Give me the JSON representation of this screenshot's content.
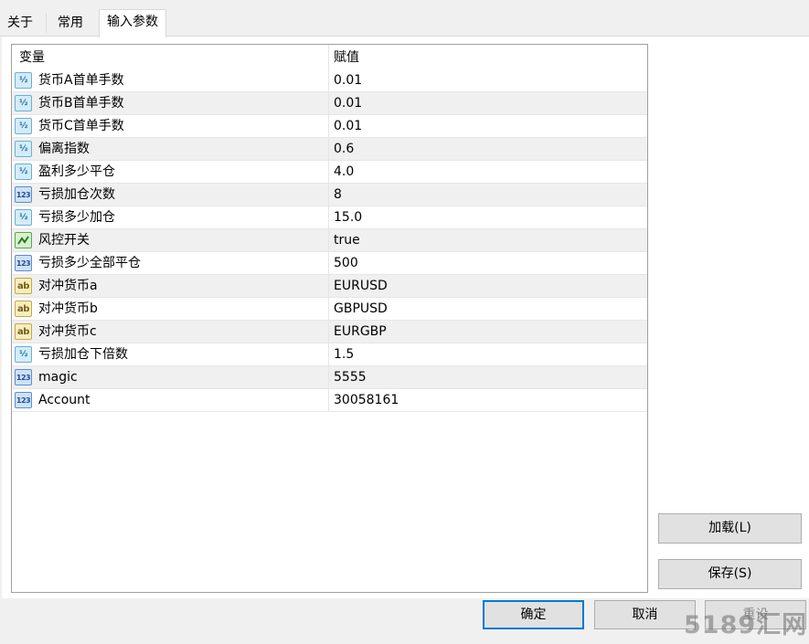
{
  "tabs": [
    {
      "label": "关于"
    },
    {
      "label": "常用"
    },
    {
      "label": "输入参数"
    }
  ],
  "grid": {
    "headers": {
      "variable": "变量",
      "value": "赋值"
    },
    "rows": [
      {
        "name": "货币A首单手数",
        "value": "0.01",
        "type": "double",
        "icon": "fraction-icon"
      },
      {
        "name": "货币B首单手数",
        "value": "0.01",
        "type": "double",
        "icon": "fraction-icon"
      },
      {
        "name": "货币C首单手数",
        "value": "0.01",
        "type": "double",
        "icon": "fraction-icon"
      },
      {
        "name": "偏离指数",
        "value": "0.6",
        "type": "double",
        "icon": "fraction-icon"
      },
      {
        "name": "盈利多少平仓",
        "value": "4.0",
        "type": "double",
        "icon": "fraction-icon"
      },
      {
        "name": "亏损加仓次数",
        "value": "8",
        "type": "int",
        "icon": "integer-icon"
      },
      {
        "name": "亏损多少加仓",
        "value": "15.0",
        "type": "double",
        "icon": "fraction-icon"
      },
      {
        "name": "风控开关",
        "value": "true",
        "type": "bool",
        "icon": "boolean-icon"
      },
      {
        "name": "亏损多少全部平仓",
        "value": "500",
        "type": "int",
        "icon": "integer-icon"
      },
      {
        "name": "对冲货币a",
        "value": "EURUSD",
        "type": "string",
        "icon": "string-icon"
      },
      {
        "name": "对冲货币b",
        "value": "GBPUSD",
        "type": "string",
        "icon": "string-icon"
      },
      {
        "name": "对冲货币c",
        "value": "EURGBP",
        "type": "string",
        "icon": "string-icon"
      },
      {
        "name": "亏损加仓下倍数",
        "value": "1.5",
        "type": "double",
        "icon": "fraction-icon"
      },
      {
        "name": "magic",
        "value": "5555",
        "type": "int",
        "icon": "integer-icon"
      },
      {
        "name": "Account",
        "value": "30058161",
        "type": "int",
        "icon": "integer-icon"
      }
    ]
  },
  "icon_glyphs": {
    "double": "½",
    "int": "123",
    "string": "ab"
  },
  "buttons": {
    "load": "加载(L)",
    "save": "保存(S)",
    "ok": "确定",
    "cancel": "取消",
    "reset": "重设"
  },
  "watermark": "5189汇网",
  "colors": {
    "primary_border": "#0078d7",
    "row_alt": "#f0f0f0"
  }
}
